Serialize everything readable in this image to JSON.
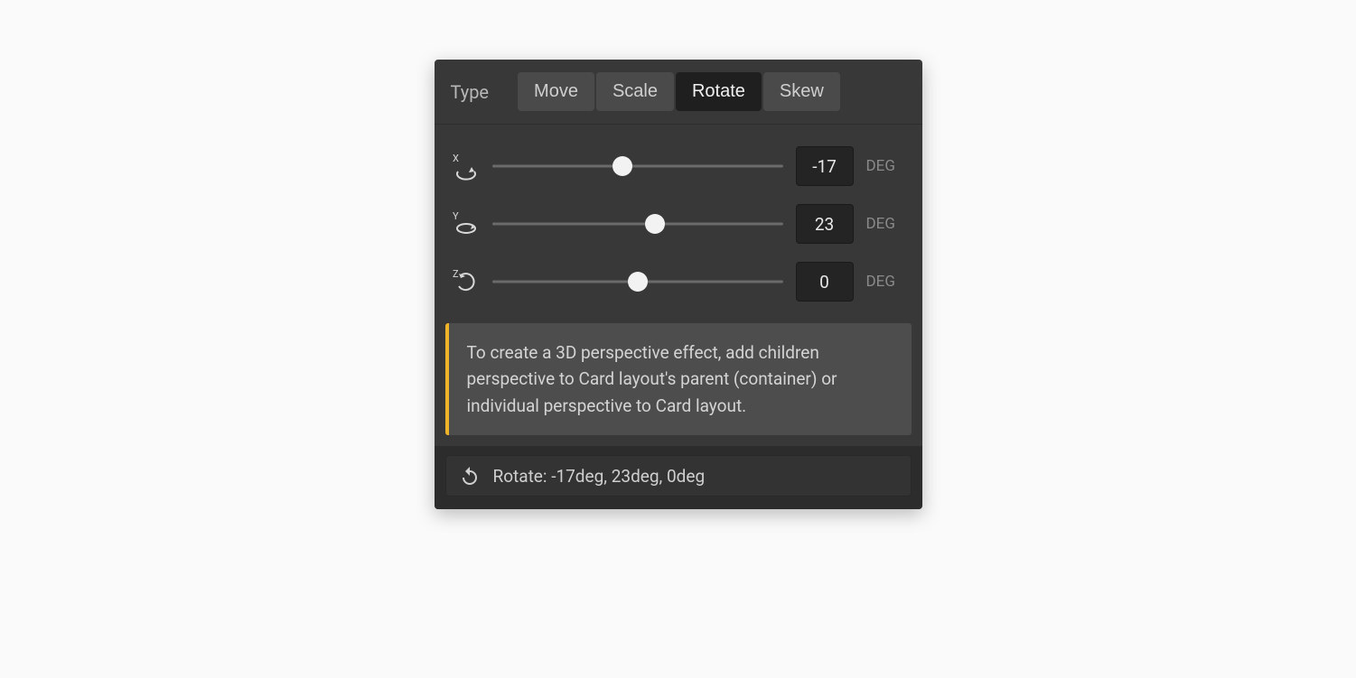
{
  "type_label": "Type",
  "tabs": {
    "move": "Move",
    "scale": "Scale",
    "rotate": "Rotate",
    "skew": "Skew",
    "active": "rotate"
  },
  "axes": {
    "x": {
      "label": "X",
      "value": "-17",
      "unit": "DEG",
      "pos": 45
    },
    "y": {
      "label": "Y",
      "value": "23",
      "unit": "DEG",
      "pos": 56
    },
    "z": {
      "label": "Z",
      "value": "0",
      "unit": "DEG",
      "pos": 50
    }
  },
  "hint": "To create a 3D perspective effect, add children perspective to Card layout's parent (container) or individual perspective to Card layout.",
  "summary": "Rotate: -17deg, 23deg, 0deg"
}
